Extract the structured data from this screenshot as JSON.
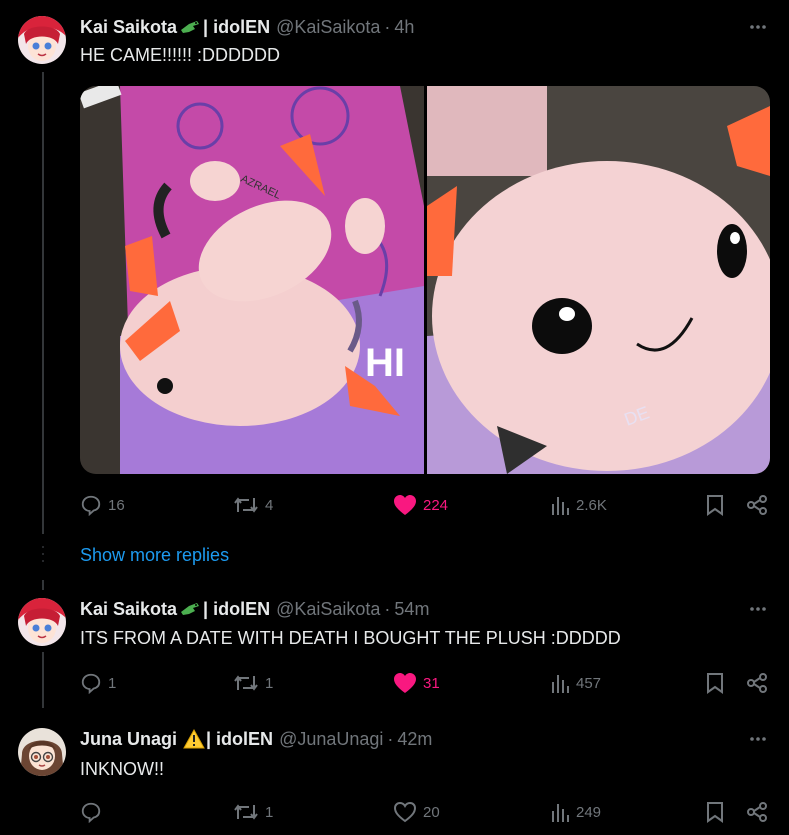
{
  "tweets": [
    {
      "name": "Kai Saikota",
      "affiliation": "| idolEN",
      "handle": "@KaiSaikota",
      "separator": "·",
      "time": "4h",
      "text": "HE CAME!!!!!! :DDDDDD",
      "replies": "16",
      "reposts": "4",
      "likes": "224",
      "views": "2.6K",
      "liked": true
    },
    {
      "name": "Kai Saikota",
      "affiliation": "| idolEN",
      "handle": "@KaiSaikota",
      "separator": "·",
      "time": "54m",
      "text": "ITS FROM A DATE WITH DEATH I BOUGHT THE PLUSH :DDDDD",
      "replies": "1",
      "reposts": "1",
      "likes": "31",
      "views": "457",
      "liked": true
    },
    {
      "name": "Juna Unagi",
      "affiliation": "| idolEN",
      "handle": "@JunaUnagi",
      "separator": "·",
      "time": "42m",
      "text": "INKNOW!!",
      "replies": "",
      "reposts": "1",
      "likes": "20",
      "views": "249",
      "liked": false
    }
  ],
  "show_more_replies": "Show more replies",
  "media": {
    "left_label": "AZRAEL",
    "right_label": "DE",
    "left_overlay": "HI"
  },
  "colors": {
    "accent": "#1d9bf0",
    "like": "#f91880",
    "muted": "#71767b"
  },
  "icons": [
    "reply-icon",
    "repost-icon",
    "like-icon",
    "views-icon",
    "bookmark-icon",
    "share-icon",
    "more-icon",
    "crocodile-emoji-icon",
    "warning-emoji-icon"
  ]
}
